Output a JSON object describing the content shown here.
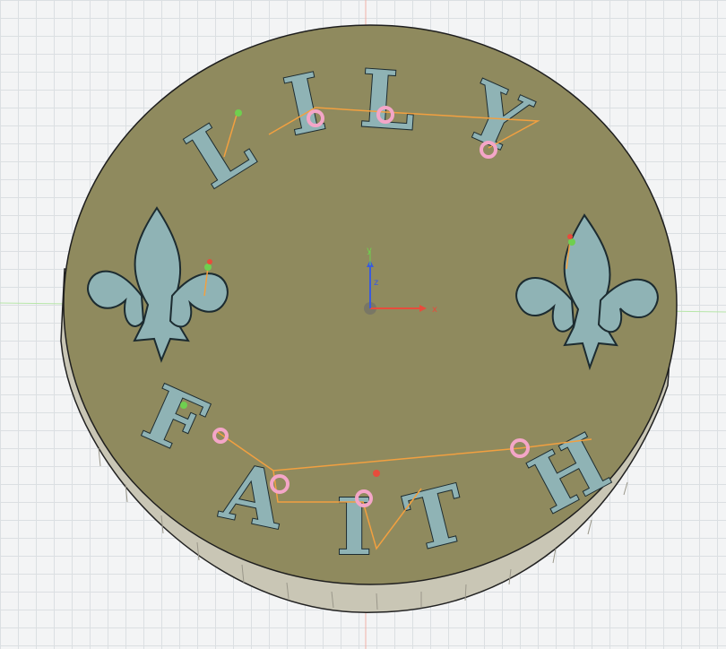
{
  "viewport": {
    "background": "#f3f4f5",
    "grid_color": "#d9dde1",
    "axis_colors": {
      "x": "#e74c3c",
      "y": "#6fcf4f",
      "z": "#3b5bdb"
    },
    "axis_labels": {
      "x": "x",
      "y": "y",
      "z": "z"
    }
  },
  "model": {
    "part": "coin",
    "top_color": "#8f8a5e",
    "edge_color": "#bdbaa8",
    "text_top": [
      "L",
      "I",
      "L",
      "Y"
    ],
    "text_bottom": [
      "F",
      "A",
      "I",
      "T",
      "H"
    ],
    "symbols": [
      "fleur-de-lis-left",
      "fleur-de-lis-right"
    ],
    "toolpath_color": "#f2a040",
    "plunge_marker_color": "#f4a6c8"
  }
}
